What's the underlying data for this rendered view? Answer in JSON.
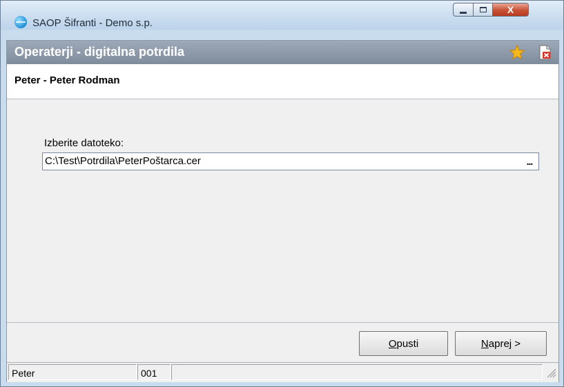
{
  "window": {
    "title": "SAOP Šifranti - Demo s.p.",
    "controls": {
      "minimize_icon": "minimize-icon",
      "maximize_icon": "maximize-icon",
      "close_label": "X"
    }
  },
  "form": {
    "title": "Operaterji - digitalna potrdila",
    "favorite_icon": "star-icon",
    "close_form_icon": "document-close-icon"
  },
  "subheader": {
    "title": "Peter - Peter Rodman"
  },
  "file_picker": {
    "label": "Izberite datoteko:",
    "value": "C:\\Test\\Potrdila\\PeterPoštarca.cer",
    "browse_label": "..."
  },
  "buttons": {
    "cancel": {
      "label_underlined": "O",
      "label_rest": "pusti"
    },
    "next": {
      "label_underlined": "N",
      "label_rest": "aprej >"
    }
  },
  "statusbar": {
    "user": "Peter",
    "code": "001",
    "extra": ""
  },
  "colors": {
    "titlebar": "#cddff0",
    "form_header": "#8d99a8",
    "close_button": "#c75236",
    "star": "#f5b81c"
  }
}
